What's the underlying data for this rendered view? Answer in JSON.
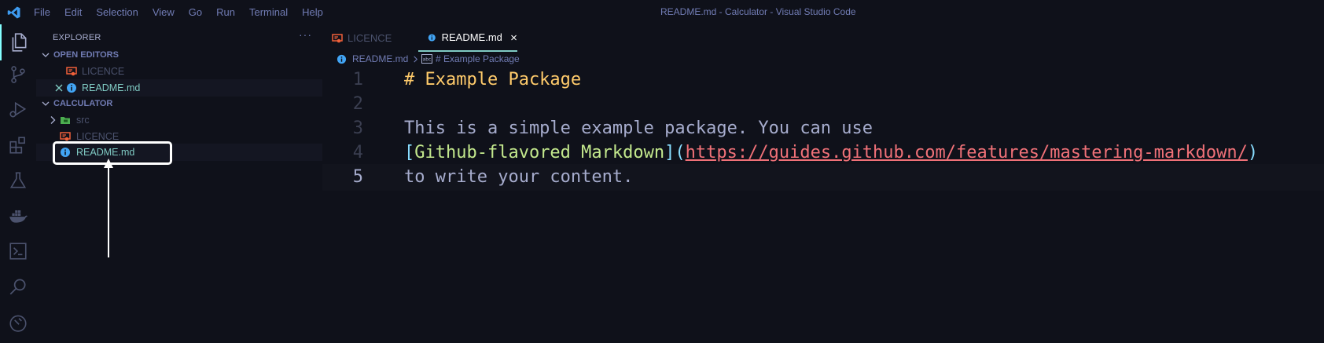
{
  "window": {
    "title": "README.md - Calculator - Visual Studio Code",
    "menu": [
      "File",
      "Edit",
      "Selection",
      "View",
      "Go",
      "Run",
      "Terminal",
      "Help"
    ]
  },
  "activity_bar": {
    "items": [
      "explorer-icon",
      "source-control-icon",
      "run-debug-icon",
      "extensions-icon",
      "testing-icon",
      "docker-icon",
      "terminal-icon",
      "search-icon",
      "remote-icon"
    ]
  },
  "sidebar": {
    "title": "EXPLORER",
    "more": "···",
    "open_editors": {
      "label": "OPEN EDITORS",
      "items": [
        {
          "name": "LICENCE",
          "icon": "licence-icon"
        },
        {
          "name": "README.md",
          "icon": "info-icon"
        }
      ]
    },
    "project": {
      "label": "CALCULATOR",
      "items": [
        {
          "name": "src",
          "icon": "folder-icon"
        },
        {
          "name": "LICENCE",
          "icon": "licence-icon"
        },
        {
          "name": "README.md",
          "icon": "info-icon"
        }
      ]
    }
  },
  "editor": {
    "tabs": [
      {
        "label": "LICENCE",
        "active": false
      },
      {
        "label": "README.md",
        "active": true
      }
    ],
    "breadcrumb": {
      "file": "README.md",
      "symbol": "# Example Package"
    },
    "lines": [
      {
        "num": "1",
        "heading": "# Example Package"
      },
      {
        "num": "2"
      },
      {
        "num": "3",
        "text": "This is a simple example package. You can use"
      },
      {
        "num": "4",
        "open_bracket": "[",
        "link_text": "Github-flavored Markdown",
        "mid": "](",
        "url": "https://guides.github.com/features/mastering-markdown/",
        "close": ")"
      },
      {
        "num": "5",
        "text": "to write your content."
      }
    ]
  },
  "colors": {
    "background": "#0f111a",
    "accent": "#84ffff",
    "heading": "#ffcb6b",
    "link_text": "#c3e88d",
    "url": "#f07178",
    "licence_icon": "#f0613a",
    "info_icon": "#42a5f5",
    "folder_icon": "#4caf50"
  }
}
